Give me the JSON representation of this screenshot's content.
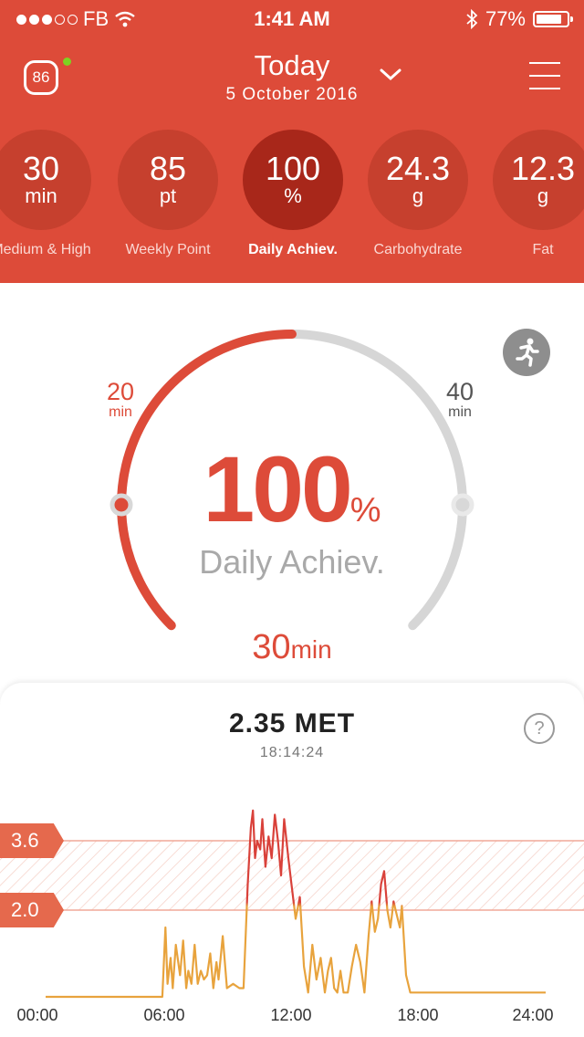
{
  "status_bar": {
    "carrier": "FB",
    "time": "1:41 AM",
    "battery": "77%"
  },
  "header": {
    "score": "86",
    "title": "Today",
    "date": "5 October 2016"
  },
  "summary": [
    {
      "value": "30",
      "unit": "min",
      "label": "Medium & High"
    },
    {
      "value": "85",
      "unit": "pt",
      "label": "Weekly Point"
    },
    {
      "value": "100",
      "unit": "%",
      "label": "Daily Achiev."
    },
    {
      "value": "24.3",
      "unit": "g",
      "label": "Carbohydrate"
    },
    {
      "value": "12.3",
      "unit": "g",
      "label": "Fat"
    }
  ],
  "gauge": {
    "min_value": "20",
    "min_unit": "min",
    "max_value": "40",
    "max_unit": "min",
    "percent": "100",
    "percent_sign": "%",
    "label": "Daily Achiev.",
    "duration_value": "30",
    "duration_unit": "min",
    "progress_fraction": 0.5,
    "colors": {
      "accent": "#dd4b39",
      "track": "#d6d6d6"
    }
  },
  "met": {
    "value": "2.35 MET",
    "time": "18:14:24"
  },
  "colors": {
    "header": "#dd4b39",
    "low_line": "#e8a33d",
    "high_line": "#d9413a",
    "peak_line": "#8c1a1a"
  },
  "chart_data": {
    "type": "line",
    "title": "",
    "xlabel": "",
    "ylabel": "",
    "x_ticks": [
      "00:00",
      "06:00",
      "12:00",
      "18:00",
      "24:00"
    ],
    "xlim": [
      0,
      24
    ],
    "ylim": [
      0,
      5.2
    ],
    "thresholds": [
      {
        "label": "3.6",
        "value": 3.6
      },
      {
        "label": "2.0",
        "value": 2.0
      }
    ],
    "grid": false,
    "series": [
      {
        "x": [
          0,
          5.6,
          5.75,
          5.85,
          6.0,
          6.1,
          6.25,
          6.45,
          6.6,
          6.75,
          6.85,
          7.0,
          7.15,
          7.3,
          7.45,
          7.6,
          7.75,
          7.9,
          8.05,
          8.2,
          8.3,
          8.5,
          8.7,
          9.0,
          9.3,
          9.5,
          9.7,
          9.85,
          9.95,
          10.05,
          10.15,
          10.3,
          10.4,
          10.55,
          10.7,
          10.85,
          11.0,
          11.15,
          11.3,
          11.45,
          11.65,
          11.8,
          12.0,
          12.2,
          12.4,
          12.6,
          12.8,
          13.0,
          13.2,
          13.4,
          13.55,
          13.7,
          13.85,
          14.0,
          14.15,
          14.3,
          14.5,
          14.7,
          14.9,
          15.1,
          15.3,
          15.5,
          15.65,
          15.8,
          15.95,
          16.1,
          16.25,
          16.4,
          16.55,
          16.7,
          16.85,
          17.0,
          17.1,
          17.3,
          17.5,
          18.0,
          24.0
        ],
        "y": [
          0,
          0,
          1.6,
          0.3,
          0.9,
          0.2,
          1.2,
          0.5,
          1.3,
          0.2,
          0.6,
          0.3,
          1.2,
          0.3,
          0.6,
          0.4,
          0.5,
          1.0,
          0.2,
          0.8,
          0.4,
          1.4,
          0.2,
          0.3,
          0.2,
          0.2,
          2.6,
          3.9,
          4.3,
          3.2,
          3.6,
          3.4,
          4.1,
          3.0,
          3.7,
          3.2,
          4.2,
          3.6,
          2.8,
          4.1,
          3.2,
          2.6,
          1.8,
          2.3,
          0.7,
          0.1,
          1.2,
          0.4,
          0.9,
          0.1,
          0.6,
          0.9,
          0.2,
          0.1,
          0.6,
          0.1,
          0.1,
          0.7,
          1.2,
          0.8,
          0.1,
          1.4,
          2.2,
          1.5,
          1.8,
          2.6,
          2.9,
          2.0,
          1.6,
          2.2,
          1.9,
          1.6,
          2.1,
          0.5,
          0.1,
          0.1,
          0.1
        ]
      }
    ]
  }
}
